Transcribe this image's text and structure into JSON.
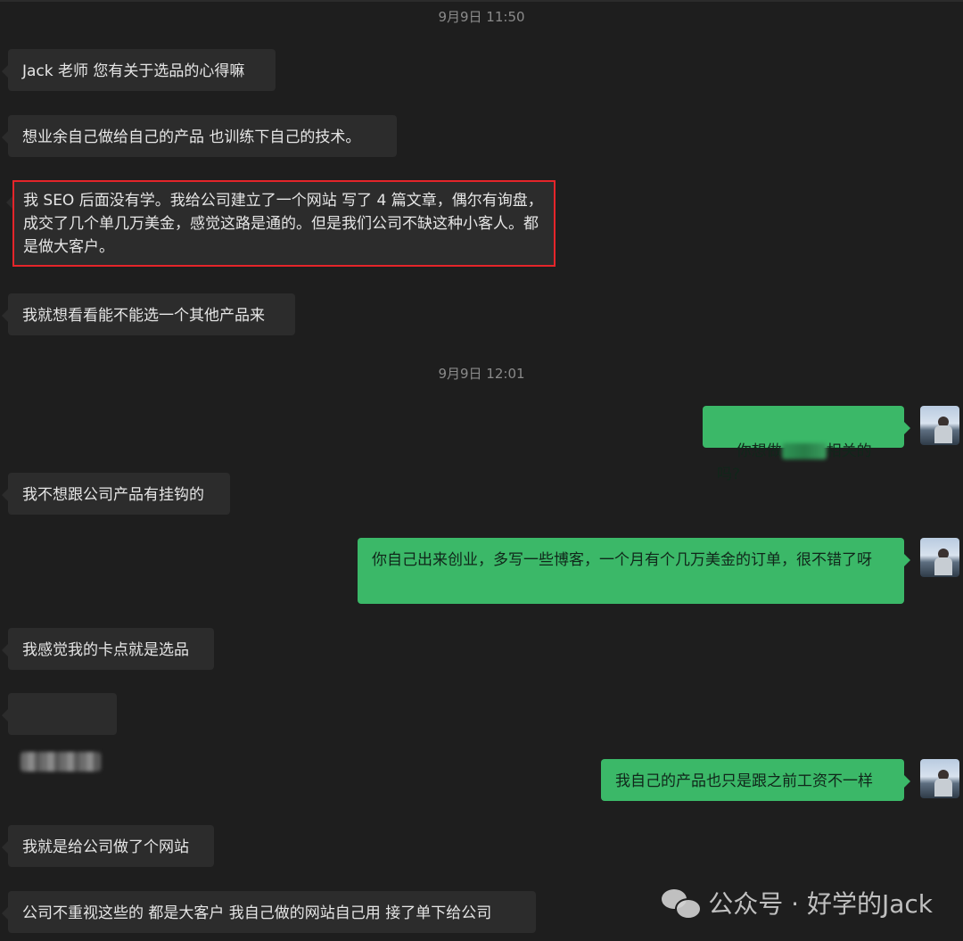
{
  "timestamps": [
    "9月9日 11:50",
    "9月9日 12:01"
  ],
  "messages": {
    "m1": "Jack 老师 您有关于选品的心得嘛",
    "m2": "想业余自己做给自己的产品 也训练下自己的技术。",
    "m3": "我 SEO 后面没有学。我给公司建立了一个网站 写了 4 篇文章，偶尔有询盘，成交了几个单几万美金，感觉这路是通的。但是我们公司不缺这种小客人。都是做大客户。",
    "m4": "我就想看看能不能选一个其他产品来",
    "m5_prefix": "你想做",
    "m5_suffix": "相关的吗?",
    "m6": "我不想跟公司产品有挂钩的",
    "m7": "你自己出来创业，多写一些博客，一个月有个几万美金的订单，很不错了呀",
    "m8": "我感觉我的卡点就是选品",
    "m10": "我自己的产品也只是跟之前工资不一样",
    "m11": "我就是给公司做了个网站",
    "m12": "公司不重视这些的 都是大客户 我自己做的网站自己用 接了单下给公司"
  },
  "watermark": {
    "text": "公众号 · 好学的Jack",
    "icon": "wechat-icon"
  },
  "colors": {
    "background": "#1e1e1e",
    "incoming_bubble": "#2c2c2c",
    "outgoing_bubble": "#3bb868",
    "highlight_border": "#e5252a"
  }
}
